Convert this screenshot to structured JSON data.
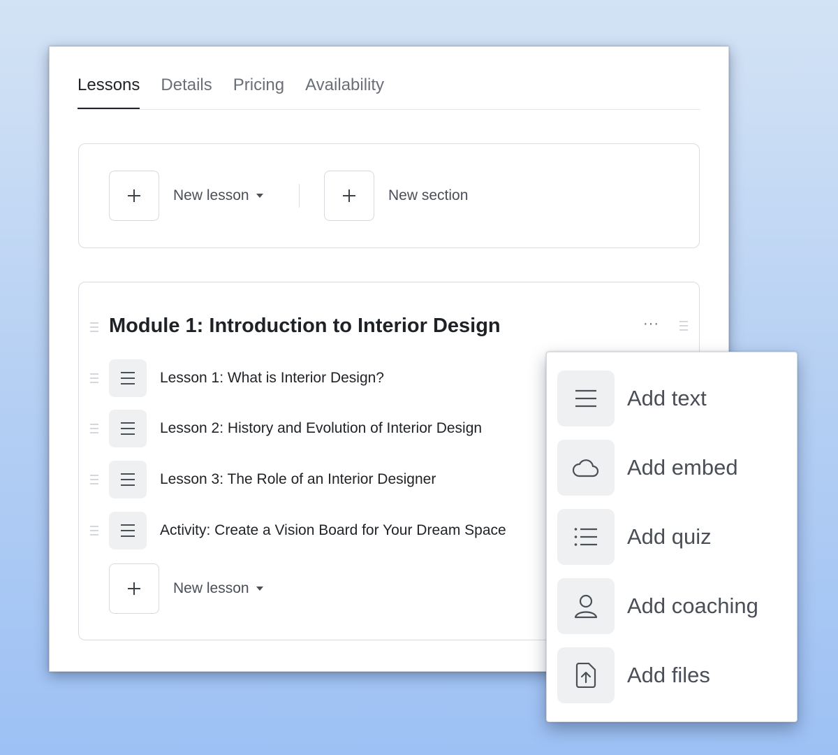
{
  "tabs": [
    {
      "label": "Lessons",
      "active": true
    },
    {
      "label": "Details",
      "active": false
    },
    {
      "label": "Pricing",
      "active": false
    },
    {
      "label": "Availability",
      "active": false
    }
  ],
  "toolbar": {
    "new_lesson_label": "New lesson",
    "new_section_label": "New section"
  },
  "module": {
    "title": "Module 1: Introduction to Interior Design",
    "more_label": "···",
    "lessons": [
      {
        "title": "Lesson 1: What is Interior Design?"
      },
      {
        "title": "Lesson 2: History and Evolution of Interior Design"
      },
      {
        "title": "Lesson 3: The Role of an Interior Designer"
      },
      {
        "title": "Activity: Create a Vision Board for Your Dream Space"
      }
    ],
    "new_lesson_label": "New lesson"
  },
  "menu": {
    "items": [
      {
        "label": "Add text",
        "icon": "text-lines-icon"
      },
      {
        "label": "Add embed",
        "icon": "cloud-icon"
      },
      {
        "label": "Add quiz",
        "icon": "list-icon"
      },
      {
        "label": "Add coaching",
        "icon": "person-icon"
      },
      {
        "label": "Add files",
        "icon": "file-upload-icon"
      }
    ]
  },
  "colors": {
    "background_top": "#d3e3f5",
    "background_bottom": "#9dc1f4",
    "text_primary": "#1f2226",
    "text_secondary": "#4a4f57",
    "icon_bg": "#eff0f2"
  }
}
